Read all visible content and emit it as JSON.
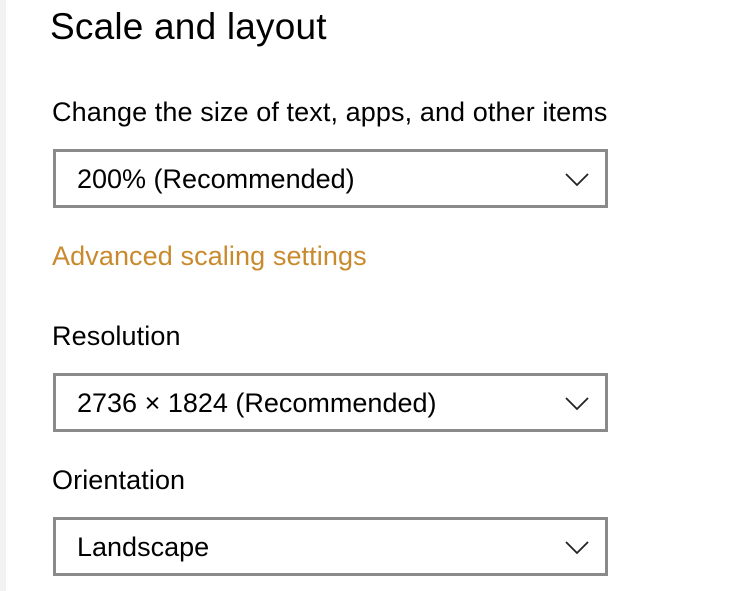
{
  "section": {
    "title": "Scale and layout"
  },
  "scale": {
    "label": "Change the size of text, apps, and other items",
    "value": "200% (Recommended)"
  },
  "advanced_link": {
    "label": "Advanced scaling settings",
    "color": "#c98a2e"
  },
  "resolution": {
    "label": "Resolution",
    "value": "2736 × 1824 (Recommended)"
  },
  "orientation": {
    "label": "Orientation",
    "value": "Landscape"
  },
  "icons": {
    "dropdown_chevron": "chevron-down-icon"
  }
}
